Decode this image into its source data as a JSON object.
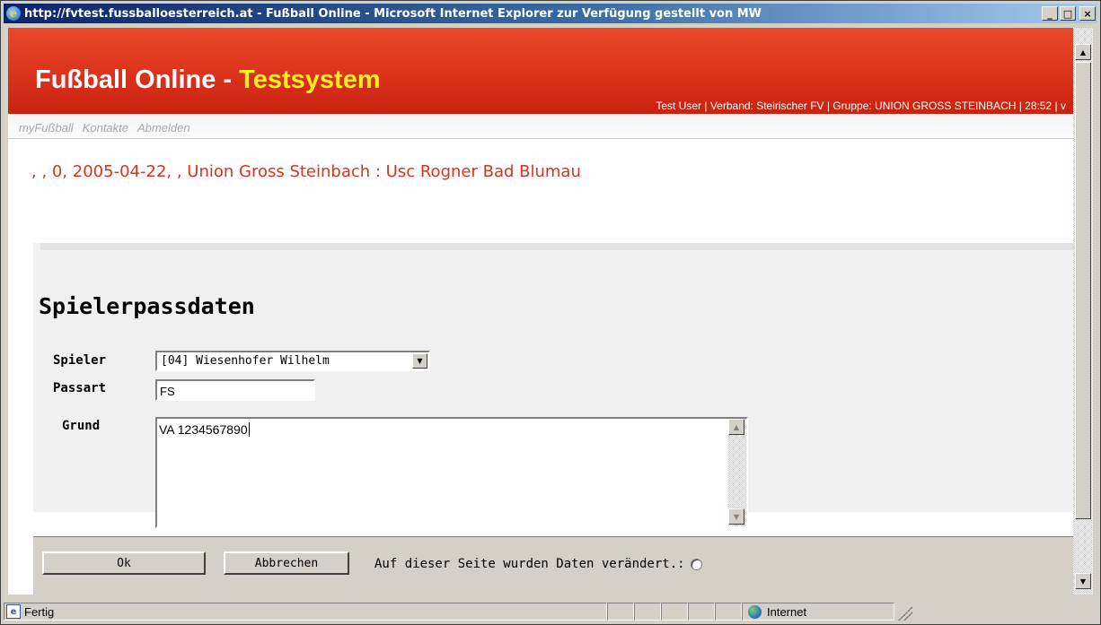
{
  "window": {
    "title": "http://fvtest.fussballoesterreich.at - Fußball Online - Microsoft Internet Explorer  zur Verfügung gestellt von MW",
    "minimize": "_",
    "maximize": "□",
    "close": "×"
  },
  "header": {
    "brand_main": "Fußball Online - ",
    "brand_accent": "Testsystem",
    "user_info": "Test User | Verband: Steirischer FV | Gruppe: UNION GROSS STEINBACH | 28:52 | v",
    "accent_color": "#ffef1f",
    "background_color": "#d9301a"
  },
  "nav": {
    "items": [
      "myFußball",
      "Kontakte",
      "Abmelden"
    ]
  },
  "match": {
    "title": ", , 0, 2005-04-22, , Union Gross Steinbach : Usc Rogner Bad Blumau",
    "color": "#d8341c"
  },
  "form": {
    "section_title": "Spielerpassdaten",
    "spieler_label": "Spieler",
    "spieler_value": "[04] Wiesenhofer Wilhelm",
    "passart_label": "Passart",
    "passart_value": "FS",
    "grund_label": "Grund",
    "grund_value": "VA 1234567890"
  },
  "buttons": {
    "ok": "Ok",
    "cancel": "Abbrechen",
    "changed_label": "Auf dieser Seite wurden Daten verändert.:"
  },
  "statusbar": {
    "status": "Fertig",
    "zone": "Internet"
  },
  "icons": {
    "ie": "ie-icon",
    "page": "page-icon",
    "globe": "globe-icon"
  }
}
